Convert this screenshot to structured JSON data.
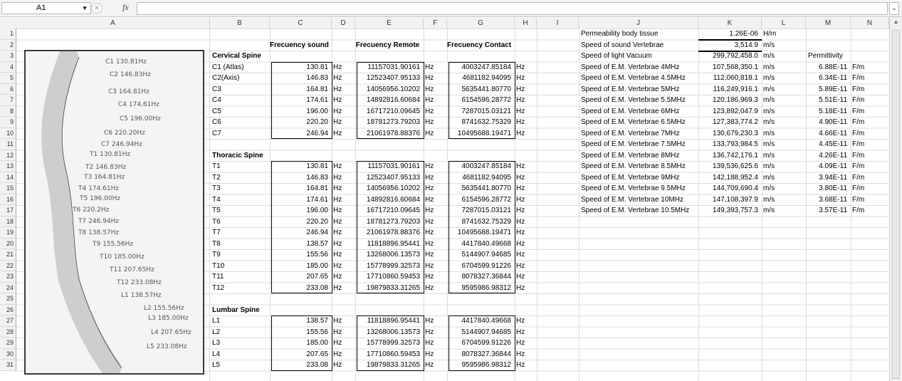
{
  "formula_bar": {
    "cell_ref": "A1",
    "fx": "fx",
    "value": ""
  },
  "columns": [
    "A",
    "B",
    "C",
    "D",
    "E",
    "F",
    "G",
    "H",
    "I",
    "J",
    "K",
    "L",
    "M",
    "N"
  ],
  "rows": [
    "1",
    "2",
    "3",
    "4",
    "5",
    "6",
    "7",
    "8",
    "9",
    "10",
    "11",
    "12",
    "13",
    "14",
    "15",
    "16",
    "17",
    "18",
    "19",
    "20",
    "21",
    "22",
    "23",
    "24",
    "25",
    "26",
    "27",
    "28",
    "29",
    "30",
    "31"
  ],
  "headers": {
    "sound": "Frecuency sound",
    "remote": "Frecuency Remote",
    "contact": "Frecuency Contact"
  },
  "sections": {
    "cervical": "Cervical Spine",
    "thoracic": "Thoracic Spine",
    "lumbar": "Lumbar Spine"
  },
  "unit_hz": "Hz",
  "spine_rows": [
    {
      "label": "C1 (Atlas)",
      "sound": "130.81",
      "remote": "11157031.90161",
      "contact": "4003247.85184"
    },
    {
      "label": "C2(Axis)",
      "sound": "146.83",
      "remote": "12523407.95133",
      "contact": "4681182.94095"
    },
    {
      "label": "C3",
      "sound": "164.81",
      "remote": "14056956.10202",
      "contact": "5635441.80770"
    },
    {
      "label": "C4",
      "sound": "174.61",
      "remote": "14892816.60684",
      "contact": "6154596.28772"
    },
    {
      "label": "C5",
      "sound": "196.00",
      "remote": "16717210.09645",
      "contact": "7287015.03121"
    },
    {
      "label": "C6",
      "sound": "220.20",
      "remote": "18781273.79203",
      "contact": "8741632.75329"
    },
    {
      "label": "C7",
      "sound": "246.94",
      "remote": "21061978.88376",
      "contact": "10495688.19471"
    },
    {
      "label": "T1",
      "sound": "130.81",
      "remote": "11157031.90161",
      "contact": "4003247.85184"
    },
    {
      "label": "T2",
      "sound": "146.83",
      "remote": "12523407.95133",
      "contact": "4681182.94095"
    },
    {
      "label": "T3",
      "sound": "164.81",
      "remote": "14056956.10202",
      "contact": "5635441.80770"
    },
    {
      "label": "T4",
      "sound": "174.61",
      "remote": "14892816.60684",
      "contact": "6154596.28772"
    },
    {
      "label": "T5",
      "sound": "196.00",
      "remote": "16717210.09645",
      "contact": "7287015.03121"
    },
    {
      "label": "T6",
      "sound": "220.20",
      "remote": "18781273.79203",
      "contact": "8741632.75329"
    },
    {
      "label": "T7",
      "sound": "246.94",
      "remote": "21061978.88376",
      "contact": "10495688.19471"
    },
    {
      "label": "T8",
      "sound": "138.57",
      "remote": "11818896.95441",
      "contact": "4417840.49668"
    },
    {
      "label": "T9",
      "sound": "155.56",
      "remote": "13268006.13573",
      "contact": "5144907.94685"
    },
    {
      "label": "T10",
      "sound": "185.00",
      "remote": "15778999.32573",
      "contact": "6704599.91226"
    },
    {
      "label": "T11",
      "sound": "207.65",
      "remote": "17710860.59453",
      "contact": "8078327.36844"
    },
    {
      "label": "T12",
      "sound": "233.08",
      "remote": "19879833.31265",
      "contact": "9595986.98312"
    },
    {
      "label": "L1",
      "sound": "138.57",
      "remote": "11818896.95441",
      "contact": "4417840.49668"
    },
    {
      "label": "L2",
      "sound": "155.56",
      "remote": "13268006.13573",
      "contact": "5144907.94685"
    },
    {
      "label": "L3",
      "sound": "185.00",
      "remote": "15778999.32573",
      "contact": "6704599.91226"
    },
    {
      "label": "L4",
      "sound": "207.65",
      "remote": "17710860.59453",
      "contact": "8078327.36844"
    },
    {
      "label": "L5",
      "sound": "233.08",
      "remote": "19879833.31265",
      "contact": "9595986.98312"
    }
  ],
  "params": [
    {
      "label": "Permeability body tissue",
      "value": "1.26E-06",
      "unit": "H/m"
    },
    {
      "label": "Speed of sound Vertebrae",
      "value": "3,514.9",
      "unit": "m/s"
    },
    {
      "label": "Speed of light Vacuum",
      "value": "299,792,458.0",
      "unit": "m/s"
    }
  ],
  "permittivity_header": "Permittivity",
  "em_rows": [
    {
      "label": "Speed of E.M. Vertebrae 4MHz",
      "speed": "107,568,350.1",
      "unit": "m/s",
      "perm": "6.88E-11",
      "punit": "F/m"
    },
    {
      "label": "Speed of E.M. Vertebrae 4.5MHz",
      "speed": "112,060,818.1",
      "unit": "m/s",
      "perm": "6.34E-11",
      "punit": "F/m"
    },
    {
      "label": "Speed of E.M. Vertebrae 5MHz",
      "speed": "116,249,916.1",
      "unit": "m/s",
      "perm": "5.89E-11",
      "punit": "F/m"
    },
    {
      "label": "Speed of E.M. Vertebrae 5.5MHz",
      "speed": "120,186,969.3",
      "unit": "m/s",
      "perm": "5.51E-11",
      "punit": "F/m"
    },
    {
      "label": "Speed of E.M. Vertebrae 6MHz",
      "speed": "123,892,047.9",
      "unit": "m/s",
      "perm": "5.18E-11",
      "punit": "F/m"
    },
    {
      "label": "Speed of E.M. Vertebrae 6.5MHz",
      "speed": "127,383,774.2",
      "unit": "m/s",
      "perm": "4.90E-11",
      "punit": "F/m"
    },
    {
      "label": "Speed of E.M. Vertebrae 7MHz",
      "speed": "130,679,230.3",
      "unit": "m/s",
      "perm": "4.66E-11",
      "punit": "F/m"
    },
    {
      "label": "Speed of E.M. Vertebrae 7.5MHz",
      "speed": "133,793,984.5",
      "unit": "m/s",
      "perm": "4.45E-11",
      "punit": "F/m"
    },
    {
      "label": "Speed of E.M. Vertebrae 8MHz",
      "speed": "136,742,176.1",
      "unit": "m/s",
      "perm": "4.26E-11",
      "punit": "F/m"
    },
    {
      "label": "Speed of E.M. Vertebrae 8.5MHz",
      "speed": "139,536,625.6",
      "unit": "m/s",
      "perm": "4.09E-11",
      "punit": "F/m"
    },
    {
      "label": "Speed of E.M. Vertebrae 9MHz",
      "speed": "142,188,952.4",
      "unit": "m/s",
      "perm": "3.94E-11",
      "punit": "F/m"
    },
    {
      "label": "Speed of E.M. Vertebrae 9.5MHz",
      "speed": "144,709,690.4",
      "unit": "m/s",
      "perm": "3.80E-11",
      "punit": "F/m"
    },
    {
      "label": "Speed of E.M. Vertebrae 10MHz",
      "speed": "147,108,397.9",
      "unit": "m/s",
      "perm": "3.68E-11",
      "punit": "F/m"
    },
    {
      "label": "Speed of E.M. Vertebrae 10.5MHz",
      "speed": "149,393,757.3",
      "unit": "m/s",
      "perm": "3.57E-11",
      "punit": "F/m"
    }
  ],
  "photo_labels": [
    "C1 130.81Hz",
    "C2 146.83Hz",
    "C3 164.81Hz",
    "C4 174.61Hz",
    "C5 196.00Hz",
    "C6 220.20Hz",
    "C7 246.94Hz",
    "T1 130.81Hz",
    "T2 146.83Hz",
    "T3 164.81Hz",
    "T4 174.61Hz",
    "T5 196.00Hz",
    "T6 220.2Hz",
    "T7 246.94Hz",
    "T8 138.57Hz",
    "T9 155.56Hz",
    "T10 185.00Hz",
    "T11 207.65Hz",
    "T12 233.08Hz",
    "L1 138.57Hz",
    "L2 155.56Hz",
    "L3 185.00Hz",
    "L4 207.65Hz",
    "L5 233.08Hz"
  ]
}
